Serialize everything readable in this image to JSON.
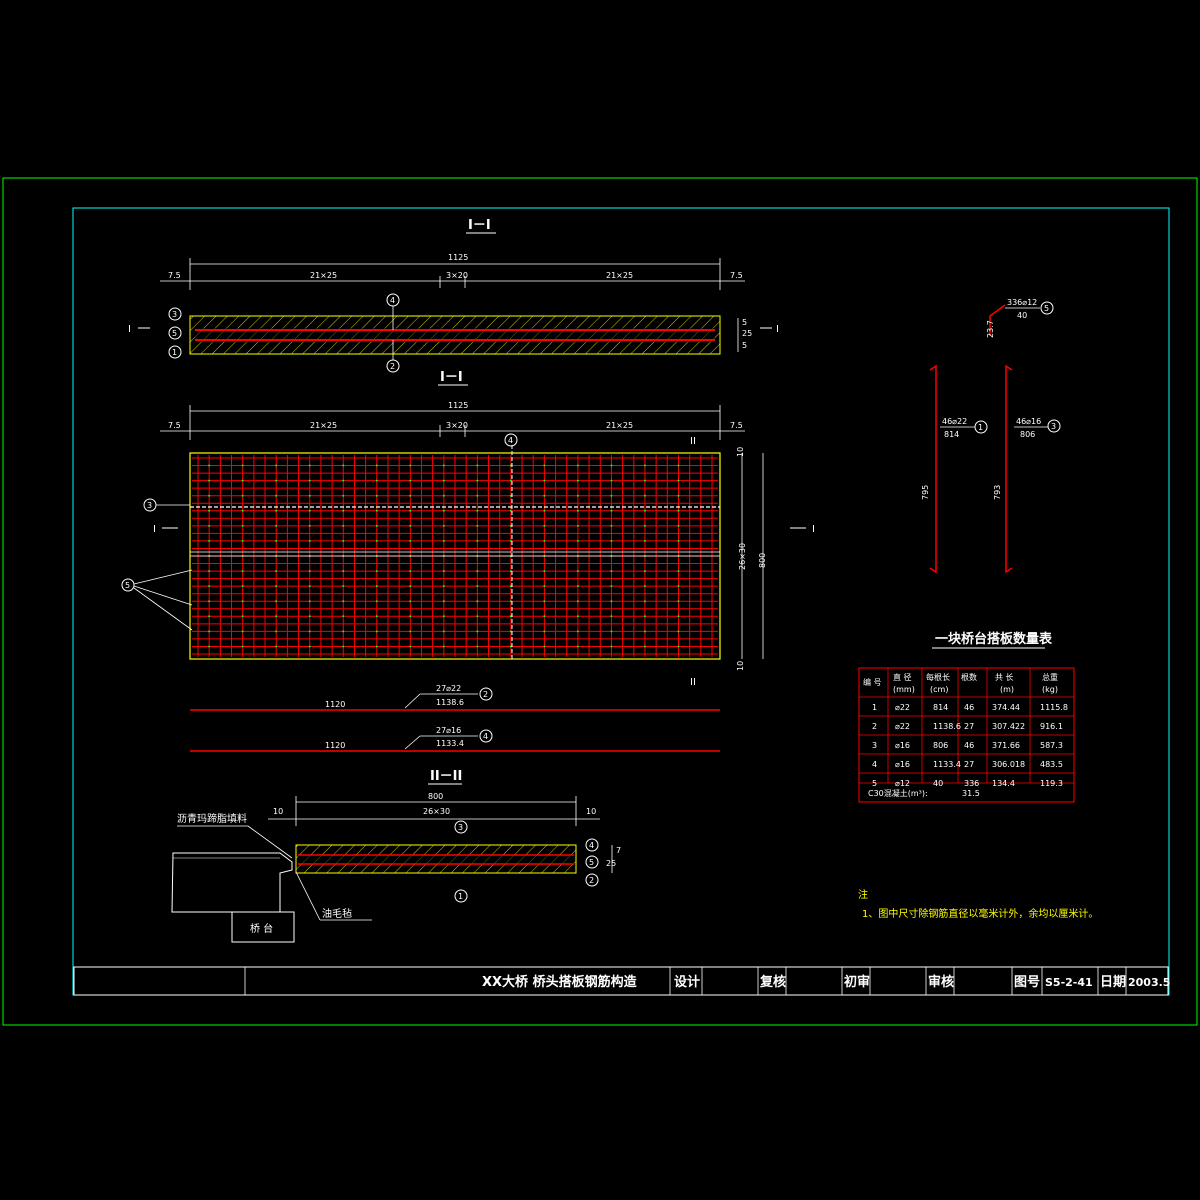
{
  "sections": {
    "top_title": "I－I",
    "mid_title": "I－I",
    "bottom_title": "II－II",
    "cut_mark": "I",
    "cut_mark_2": "II"
  },
  "top_view": {
    "overall": "1125",
    "left_edge": "7.5",
    "right_edge": "7.5",
    "seg_left": "21×25",
    "seg_mid": "3×20",
    "seg_right": "21×25",
    "side_dims": [
      "5",
      "25",
      "5"
    ],
    "labels": [
      "3",
      "5",
      "1",
      "4",
      "2"
    ]
  },
  "plan_view": {
    "overall": "1125",
    "left_edge": "7.5",
    "right_edge": "7.5",
    "seg_left": "21×25",
    "seg_mid": "3×20",
    "seg_right": "21×25",
    "right_total": "800",
    "right_seg": "26×30",
    "top_edge": "10",
    "bottom_edge": "10",
    "labels": [
      "4",
      "3",
      "5"
    ]
  },
  "bars": [
    {
      "len": "1120",
      "spec": "27⌀22",
      "length_note": "1138.6",
      "num": "2"
    },
    {
      "len": "1120",
      "spec": "27⌀16",
      "length_note": "1133.4",
      "num": "4"
    }
  ],
  "section_view": {
    "overall": "800",
    "seg": "26×30",
    "left_edge": "10",
    "right_edge": "10",
    "thick_1": "7",
    "thick_2": "25",
    "label_asphalt": "沥青玛蹄脂填料",
    "label_felt": "油毛毡",
    "label_abutment": "桥 台",
    "labels": [
      "3",
      "4",
      "5",
      "2",
      "1"
    ]
  },
  "right_details": {
    "bar5_spec": "336⌀12",
    "bar5_len": "40",
    "bar5_side": "23.7",
    "bar1_spec": "46⌀22",
    "bar1_len": "814",
    "bar1_h": "795",
    "bar3_spec": "46⌀16",
    "bar3_len": "806",
    "bar3_h": "793",
    "num_1": "1",
    "num_3": "3",
    "num_5": "5"
  },
  "table": {
    "title": "一块桥台搭板数量表",
    "headers": [
      "编 号",
      "直 径",
      "每根长",
      "根数",
      "共 长",
      "总重"
    ],
    "units": [
      "",
      "(mm)",
      "(cm)",
      "",
      "(m)",
      "(kg)"
    ],
    "rows": [
      [
        "1",
        "⌀22",
        "814",
        "46",
        "374.44",
        "1115.8"
      ],
      [
        "2",
        "⌀22",
        "1138.6",
        "27",
        "307.422",
        "916.1"
      ],
      [
        "3",
        "⌀16",
        "806",
        "46",
        "371.66",
        "587.3"
      ],
      [
        "4",
        "⌀16",
        "1133.4",
        "27",
        "306.018",
        "483.5"
      ],
      [
        "5",
        "⌀12",
        "40",
        "336",
        "134.4",
        "119.3"
      ]
    ],
    "footer_label": "C30混凝土(m³):",
    "footer_value": "31.5"
  },
  "notes": {
    "title": "注",
    "line1": "1、图中尺寸除钢筋直径以毫米计外，余均以厘米计。"
  },
  "title_block": {
    "project": "XX大桥 桥头搭板钢筋构造",
    "design": "设计",
    "check": "复核",
    "review": "初审",
    "approve": "审核",
    "fig_label": "图号",
    "fig_no": "S5-2-41",
    "date_label": "日期",
    "date": "2003.5"
  },
  "colors": {
    "background": "#000000",
    "frame_outer": "#00ff00",
    "frame_inner": "#00ffff",
    "rebar": "#ff0000",
    "concrete": "#ffff00",
    "note_text": "#ffff00"
  }
}
